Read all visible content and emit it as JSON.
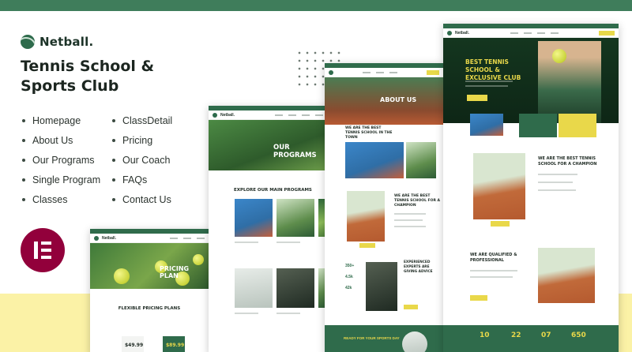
{
  "brand": {
    "name": "Netball."
  },
  "headline": "Tennis School & Sports Club",
  "menu_left": [
    "Homepage",
    "About Us",
    "Our Programs",
    "Single Program",
    "Classes"
  ],
  "menu_right": [
    "ClassDetail",
    "Pricing",
    "Our Coach",
    "FAQs",
    "Contact Us"
  ],
  "colors": {
    "brand_green": "#3f7d5b",
    "accent_yellow": "#e9d84a",
    "elementor": "#92003b",
    "bottom_band": "#fbf2a6"
  },
  "icons": {
    "elementor": "elementor-logo-icon",
    "logo": "tennis-ball-icon"
  },
  "mockups": {
    "pricing": {
      "brand": "Netball.",
      "hero_title": "PRICING PLAN",
      "section_title": "FLEXIBLE PRICING PLANS",
      "prices": [
        "$49.99",
        "$89.99"
      ]
    },
    "programs": {
      "brand": "Netball.",
      "hero_title": "OUR PROGRAMS",
      "section_title": "EXPLORE OUR MAIN PROGRAMS"
    },
    "about": {
      "hero_title": "ABOUT US",
      "block1": "WE ARE THE BEST TENNIS SCHOOL IN THE TOWN",
      "block2": "WE ARE THE BEST TENNIS SCHOOL FOR A CHAMPION",
      "block3": "EXPERIENCED EXPERTS ARE GIVING ADVICE",
      "stats": [
        "350+",
        "4.5k",
        "42k"
      ],
      "cta": "READY FOR YOUR SPORTS DAY"
    },
    "home": {
      "brand": "Netball.",
      "hero_title": "BEST TENNIS SCHOOL & EXCLUSIVE CLUB",
      "section1": "WE ARE THE BEST TENNIS SCHOOL FOR A CHAMPION",
      "section2": "WE ARE QUALIFIED & PROFESSIONAL",
      "stats": [
        "10",
        "22",
        "07",
        "650"
      ]
    }
  }
}
